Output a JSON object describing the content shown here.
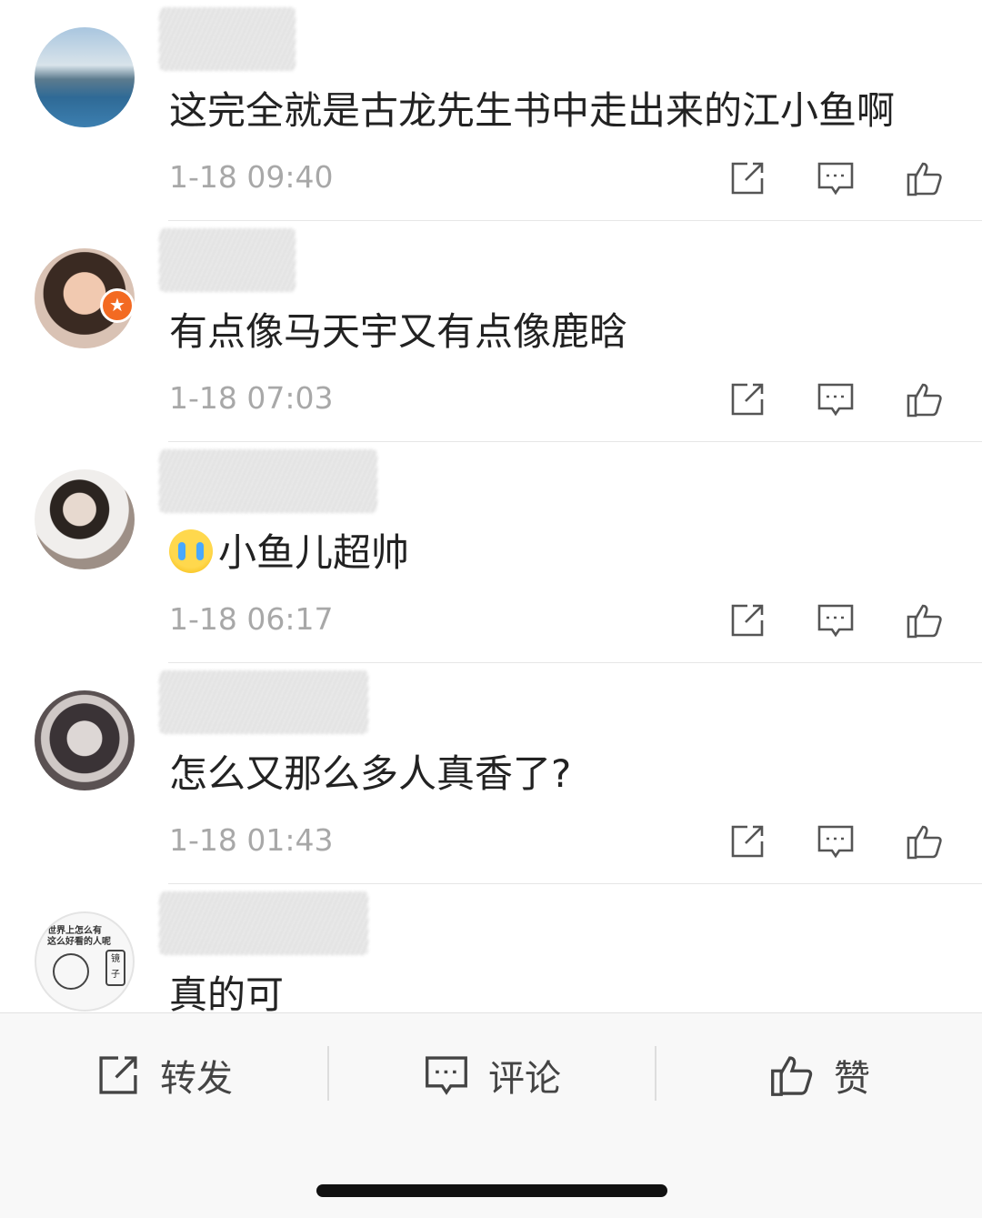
{
  "comments": [
    {
      "text": "这完全就是古龙先生书中走出来的江小鱼啊",
      "time": "1-18 09:40"
    },
    {
      "text": "有点像马天宇又有点像鹿晗",
      "time": "1-18 07:03"
    },
    {
      "text": "小鱼儿超帅",
      "time": "1-18 06:17"
    },
    {
      "text": "怎么又那么多人真香了?",
      "time": "1-18 01:43"
    },
    {
      "text": "真的可",
      "time": ""
    }
  ],
  "avatar5_caption": "世界上怎么有\n这么好看的人呢",
  "avatar5_mirror": "镜子",
  "bottom_bar": {
    "repost": "转发",
    "comment": "评论",
    "like": "赞"
  },
  "icons": {
    "share": "share-icon",
    "reply": "comment-icon",
    "like": "thumbs-up-icon",
    "badge": "verified-star-icon",
    "emoji": "crying-emoji-icon"
  },
  "colors": {
    "text": "#222222",
    "time": "#a8a8a8",
    "icon": "#555555",
    "badge": "#f36a22"
  }
}
